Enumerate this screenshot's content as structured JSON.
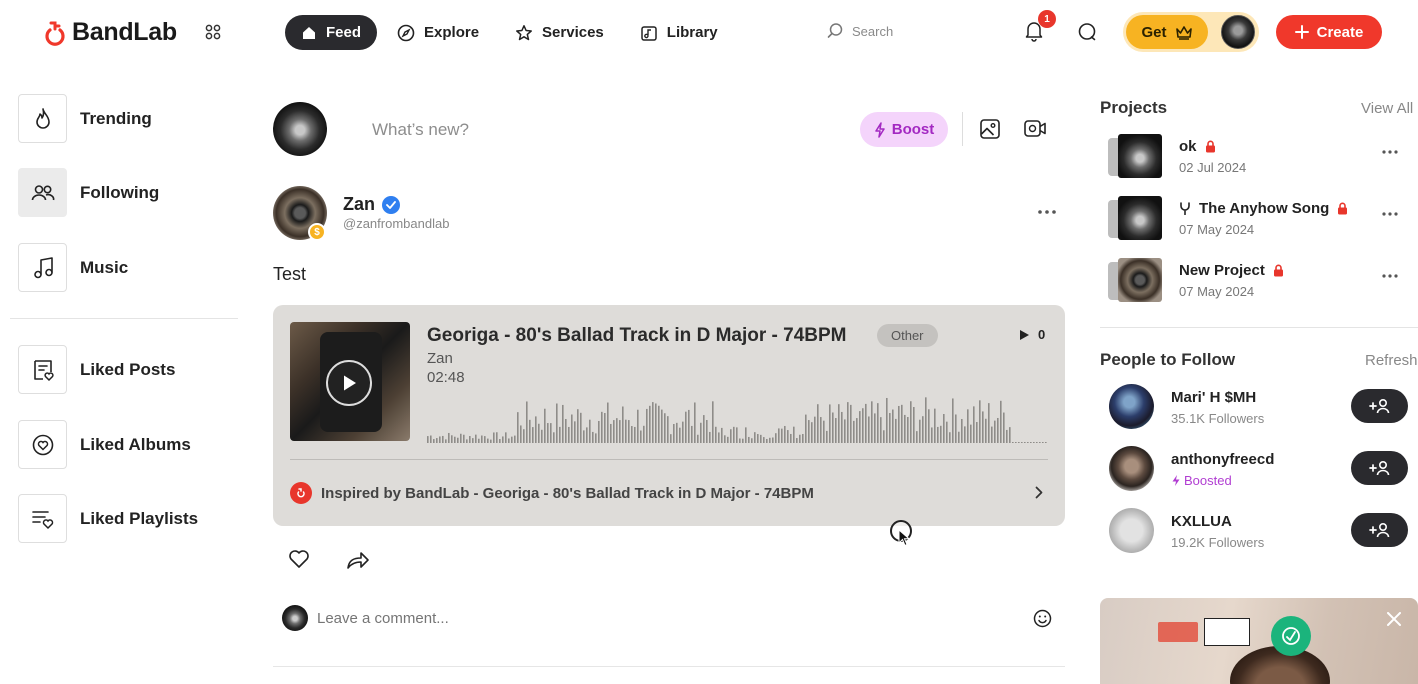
{
  "header": {
    "logo_text": "BandLab",
    "nav": [
      {
        "label": "Feed",
        "icon": "home-icon",
        "active": true
      },
      {
        "label": "Explore",
        "icon": "compass-icon",
        "active": false
      },
      {
        "label": "Services",
        "icon": "star-icon",
        "active": false
      },
      {
        "label": "Library",
        "icon": "library-icon",
        "active": false
      }
    ],
    "search_placeholder": "Search",
    "notification_count": "1",
    "get_label": "Get",
    "create_label": "Create"
  },
  "sidebar": {
    "items": [
      {
        "label": "Trending",
        "icon": "flame-icon",
        "active": false
      },
      {
        "label": "Following",
        "icon": "people-icon",
        "active": true
      },
      {
        "label": "Music",
        "icon": "music-note-icon",
        "active": false
      },
      {
        "label": "Liked Posts",
        "icon": "liked-posts-icon",
        "active": false
      },
      {
        "label": "Liked Albums",
        "icon": "liked-albums-icon",
        "active": false
      },
      {
        "label": "Liked Playlists",
        "icon": "liked-playlists-icon",
        "active": false
      }
    ]
  },
  "composer": {
    "placeholder": "What’s new?",
    "boost_label": "Boost"
  },
  "post": {
    "author": "Zan",
    "handle": "@zanfrombandlab",
    "badge": "$",
    "text": "Test",
    "track": {
      "title": "Georiga - 80's Ballad Track in D Major - 74BPM",
      "genre": "Other",
      "plays": "0",
      "artist": "Zan",
      "duration": "02:48"
    },
    "inspired_by": "Inspired by BandLab - Georiga - 80's Ballad Track in D Major - 74BPM",
    "comment_placeholder": "Leave a comment..."
  },
  "projects": {
    "heading": "Projects",
    "view_all": "View All",
    "items": [
      {
        "name": "ok",
        "date": "02 Jul 2024",
        "locked": true,
        "forked": false
      },
      {
        "name": "The Anyhow Song",
        "date": "07 May 2024",
        "locked": true,
        "forked": true
      },
      {
        "name": "New Project",
        "date": "07 May 2024",
        "locked": true,
        "forked": false
      }
    ]
  },
  "people": {
    "heading": "People to Follow",
    "refresh": "Refresh",
    "items": [
      {
        "name": "Mari' H $MH",
        "sub": "35.1K Followers",
        "boosted": false
      },
      {
        "name": "anthonyfreecd",
        "sub": "Boosted",
        "boosted": true
      },
      {
        "name": "KXLLUA",
        "sub": "19.2K Followers",
        "boosted": false
      }
    ]
  },
  "colors": {
    "accent_red": "#f0382b",
    "boost_purple": "#a329c2",
    "gold": "#f7b322",
    "dark_pill": "#2a2a2e"
  }
}
